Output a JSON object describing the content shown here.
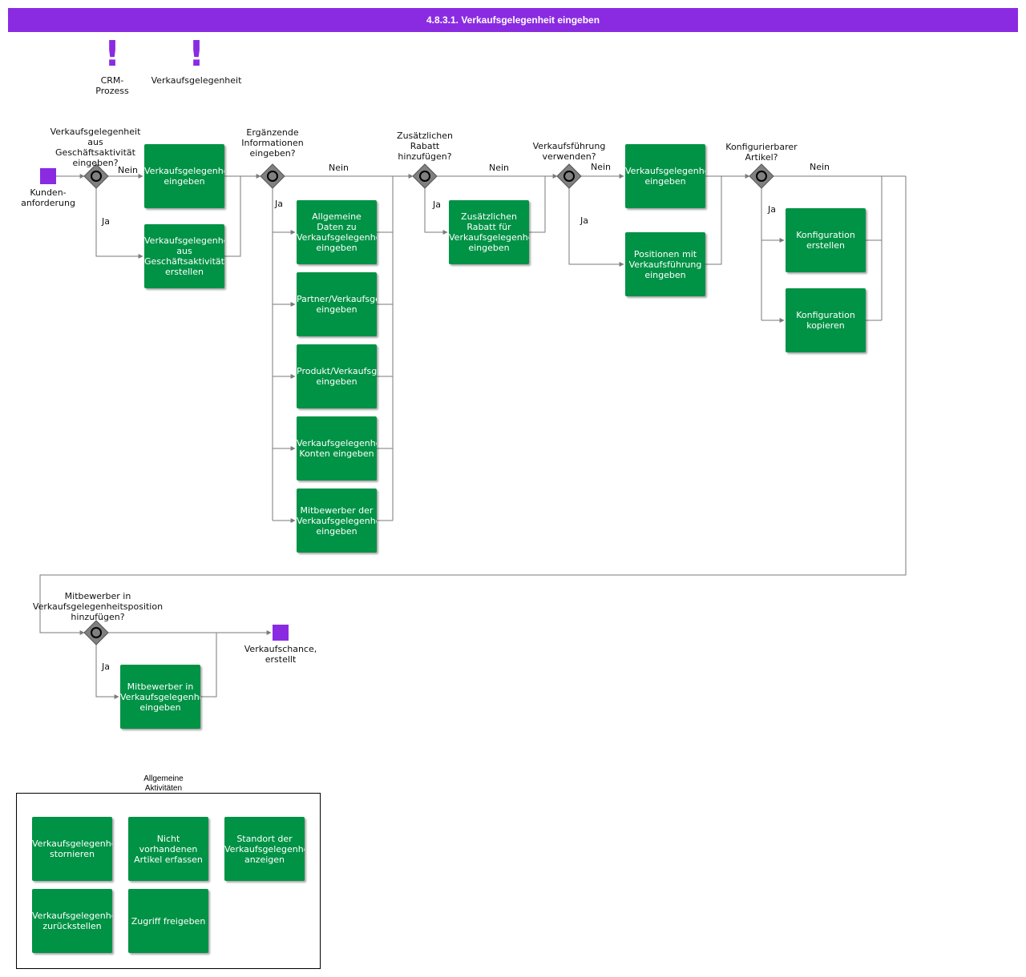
{
  "title": "4.8.3.1. Verkaufsgelegenheit eingeben",
  "refs": [
    {
      "icon": "exclamation-icon",
      "glyph": "!",
      "label": "CRM-\nProzess"
    },
    {
      "icon": "exclamation-icon",
      "glyph": "!",
      "label": "Verkaufsgelegenheit"
    }
  ],
  "events": {
    "start": "Kunden-\nanforderung",
    "end": "Verkaufschance,\nerstellt"
  },
  "gateways": {
    "g1": "Verkaufsgelegenheit\naus\nGeschäftsaktivität\neingeben?",
    "g2": "Ergänzende\nInformationen\neingeben?",
    "g3": "Zusätzlichen\nRabatt\nhinzufügen?",
    "g4": "Verkaufsführung\nverwenden?",
    "g5": "Konfigurierbarer\nArtikel?",
    "g6": "Mitbewerber in\nVerkaufsgelegenheitsposition\nhinzufügen?"
  },
  "flow_labels": {
    "nein": "Nein",
    "ja": "Ja"
  },
  "activities": {
    "a1": "Verkaufsgelegenheitskopf\neingeben",
    "a2": "Verkaufsgelegenheit\naus\nGeschäftsaktivität\nerstellen",
    "a3": "Allgemeine\nDaten zu\nVerkaufsgelegenheit\neingeben",
    "a4": "Partner/Verkaufsgelegenheit\neingeben",
    "a5": "Produkt/Verkaufsgelegenheit\neingeben",
    "a6": "Verkaufsgelegenheitsbezogene\nKonten eingeben",
    "a7": "Mitbewerber der\nVerkaufsgelegenheit\neingeben",
    "a8": "Zusätzlichen\nRabatt für\nVerkaufsgelegenheit\neingeben",
    "a9": "Verkaufsgelegenheitsposition\neingeben",
    "a10": "Positionen mit\nVerkaufsführung\neingeben",
    "a11": "Konfiguration\nerstellen",
    "a12": "Konfiguration\nkopieren",
    "a13": "Mitbewerber in\nVerkaufsgelegenheitsposition\neingeben"
  },
  "legend": {
    "title": "Allgemeine\nAktivitäten",
    "items": [
      "Verkaufsgelegenheit\nstornieren",
      "Nicht\nvorhandenen\nArtikel erfassen",
      "Standort der\nVerkaufsgelegenheit\nanzeigen",
      "Verkaufsgelegenheit\nzurückstellen",
      "Zugriff freigeben"
    ]
  },
  "colors": {
    "header": "#8a2be2",
    "event": "#8a2be2",
    "activity": "#009245",
    "gateway": "#808080",
    "line": "#7a7a7a"
  }
}
